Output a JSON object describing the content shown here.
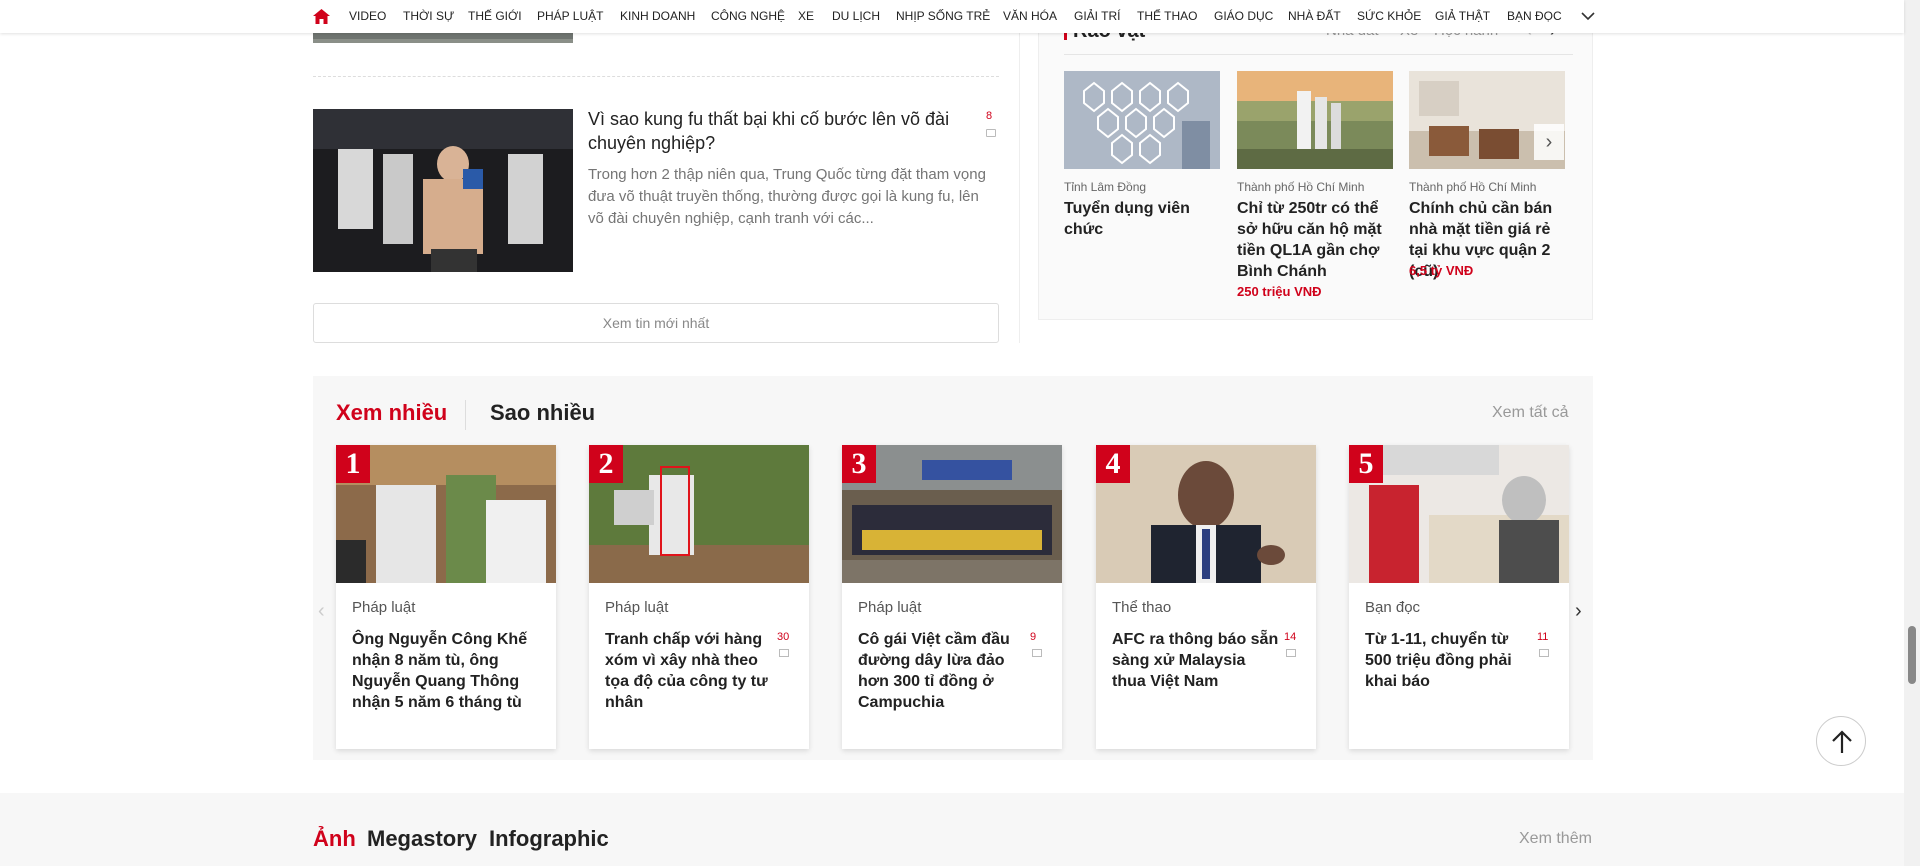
{
  "nav": {
    "items": [
      "VIDEO",
      "THỜI SỰ",
      "THẾ GIỚI",
      "PHÁP LUẬT",
      "KINH DOANH",
      "CÔNG NGHỆ",
      "XE",
      "DU LỊCH",
      "NHỊP SỐNG TRẺ",
      "VĂN HÓA",
      "GIẢI TRÍ",
      "THỂ THAO",
      "GIÁO DỤC",
      "NHÀ ĐẤT",
      "SỨC KHỎE",
      "GIẢ THẬT",
      "BẠN ĐỌC"
    ],
    "home_icon": "home-icon",
    "more_icon": "chevron-down-icon"
  },
  "article": {
    "title": "Vì sao kung fu thất bại khi cố bước lên võ đài chuyên nghiệp?",
    "description": "Trong hơn 2 thập niên qua, Trung Quốc từng đặt tham vọng đưa võ thuật truyền thống, thường được gọi là kung fu, lên võ đài chuyên nghiệp, cạnh tranh với các...",
    "comments": "8",
    "latest_button": "Xem tin mới nhất"
  },
  "raovat": {
    "title": "Rao vặt",
    "tabs": [
      "Nhà đất",
      "Xe",
      "Học hành"
    ],
    "items": [
      {
        "location": "Tỉnh Lâm Đồng",
        "title": "Tuyển dụng viên chức",
        "price": ""
      },
      {
        "location": "Thành phố Hồ Chí Minh",
        "title": "Chỉ từ 250tr có thể sở hữu căn hộ mặt tiền QL1A gần chợ Bình Chánh",
        "price": "250 triệu VNĐ"
      },
      {
        "location": "Thành phố Hồ Chí Minh",
        "title": "Chính chủ cần bán nhà mặt tiền giá rẻ tại khu vực quận 2 (cũ)",
        "price": "6,5 tỷ VNĐ"
      }
    ]
  },
  "mostviewed": {
    "tab_active": "Xem nhiều",
    "tab_other": "Sao nhiều",
    "see_all": "Xem tất cả",
    "cards": [
      {
        "rank": "1",
        "category": "Pháp luật",
        "title": "Ông Nguyễn Công Khế nhận 8 năm tù, ông Nguyễn Quang Thông nhận 5 năm 6 tháng tù",
        "comments": ""
      },
      {
        "rank": "2",
        "category": "Pháp luật",
        "title": "Tranh chấp với hàng xóm vì xây nhà theo tọa độ của công ty tư nhân",
        "comments": "30"
      },
      {
        "rank": "3",
        "category": "Pháp luật",
        "title": "Cô gái Việt cầm đầu đường dây lừa đảo hơn 300 tỉ đồng ở Campuchia",
        "comments": "9"
      },
      {
        "rank": "4",
        "category": "Thể thao",
        "title": "AFC ra thông báo sẵn sàng xử Malaysia thua Việt Nam",
        "comments": "14"
      },
      {
        "rank": "5",
        "category": "Bạn đọc",
        "title": "Từ 1-11, chuyển từ 500 triệu đồng phải khai báo",
        "comments": "11"
      }
    ]
  },
  "bottom": {
    "tabs": [
      "Ảnh",
      "Megastory",
      "Infographic"
    ],
    "more": "Xem thêm"
  },
  "colors": {
    "accent": "#d0021b",
    "text": "#222222",
    "muted": "#999999"
  }
}
